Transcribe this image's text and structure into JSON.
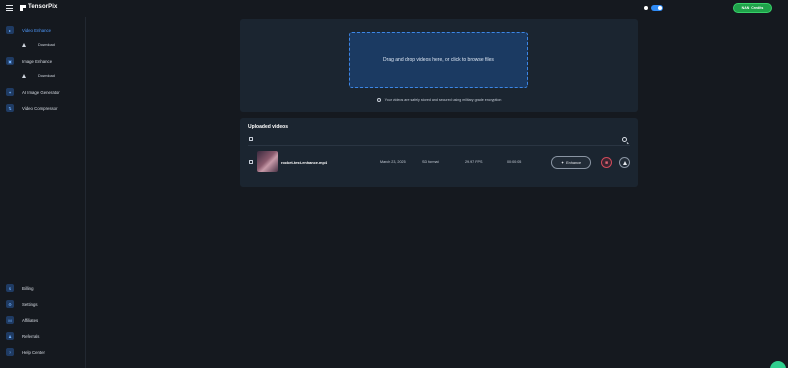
{
  "app": {
    "brand": "TensorPix"
  },
  "header": {
    "credits_label": "Credits",
    "credits_prefix": "NAN"
  },
  "sidebar": {
    "items": [
      {
        "label": "Video Enhance",
        "icon": "video-icon"
      },
      {
        "label": "Download",
        "icon": "download-icon"
      },
      {
        "label": "Image Enhance",
        "icon": "image-icon"
      },
      {
        "label": "Download",
        "icon": "download-icon"
      },
      {
        "label": "AI Image Generator",
        "icon": "wand-icon"
      },
      {
        "label": "Video Compressor",
        "icon": "compress-icon"
      }
    ],
    "bottom": [
      {
        "label": "Billing",
        "icon": "dollar-icon"
      },
      {
        "label": "Settings",
        "icon": "gear-icon"
      },
      {
        "label": "Affiliates",
        "icon": "affiliate-icon"
      },
      {
        "label": "Referrals",
        "icon": "users-icon"
      },
      {
        "label": "Help Center",
        "icon": "help-icon"
      }
    ]
  },
  "upload": {
    "dropzone_text": "Drag and drop videos here, or click to browse files",
    "secure_note": "Your videos are safely stored and secured using military grade encryption"
  },
  "videos": {
    "title": "Uploaded videos",
    "rows": [
      {
        "filename": "rocket-test-enhance.mp4",
        "date": "March 23, 2025",
        "format": "SD format",
        "fps": "29.97 FPS",
        "duration": "00:00:05",
        "enhance_label": "Enhance"
      }
    ]
  },
  "colors": {
    "accent": "#2f8bf5",
    "credits": "#1fa34a",
    "danger": "#d04a5a",
    "background": "#15191f",
    "panel": "#1b2530"
  }
}
